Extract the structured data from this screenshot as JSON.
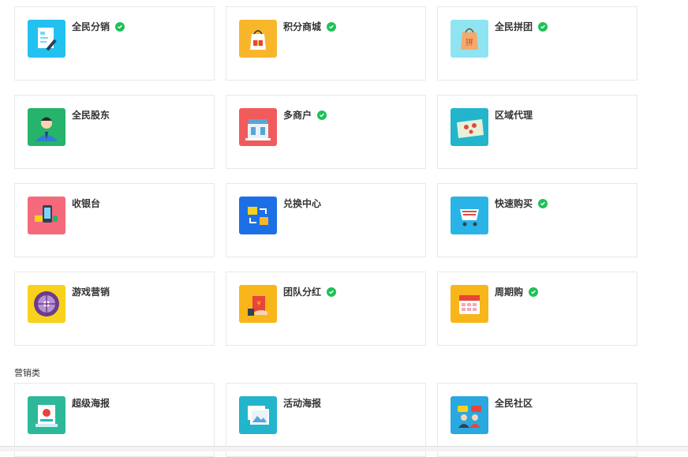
{
  "apps": [
    {
      "name": "全民分销",
      "wx": true,
      "icon": "distribution-icon",
      "color": "#22c1f0"
    },
    {
      "name": "积分商城",
      "wx": true,
      "icon": "points-mall-icon",
      "color": "#f8b62b"
    },
    {
      "name": "全民拼团",
      "wx": true,
      "icon": "group-buy-icon",
      "color": "#8fe4f2"
    },
    {
      "name": "全民股东",
      "wx": false,
      "icon": "shareholder-icon",
      "color": "#26b36b"
    },
    {
      "name": "多商户",
      "wx": true,
      "icon": "multi-merchant-icon",
      "color": "#f15b5b"
    },
    {
      "name": "区域代理",
      "wx": false,
      "icon": "regional-agent-icon",
      "color": "#22b5cc"
    },
    {
      "name": "收银台",
      "wx": false,
      "icon": "cashier-icon",
      "color": "#f56a7a"
    },
    {
      "name": "兑换中心",
      "wx": false,
      "icon": "exchange-center-icon",
      "color": "#1d6fe6"
    },
    {
      "name": "快速购买",
      "wx": true,
      "icon": "quick-buy-icon",
      "color": "#2ab3e6"
    },
    {
      "name": "游戏营销",
      "wx": false,
      "icon": "game-marketing-icon",
      "color": "#f8d21a"
    },
    {
      "name": "团队分红",
      "wx": true,
      "icon": "team-dividend-icon",
      "color": "#f8b61a"
    },
    {
      "name": "周期购",
      "wx": true,
      "icon": "cycle-purchase-icon",
      "color": "#f8b61a"
    }
  ],
  "section": "营销类",
  "marketing_apps": [
    {
      "name": "超级海报",
      "wx": false,
      "icon": "super-poster-icon",
      "color": "#2eb89a"
    },
    {
      "name": "活动海报",
      "wx": false,
      "icon": "activity-poster-icon",
      "color": "#22b5cc"
    },
    {
      "name": "全民社区",
      "wx": false,
      "icon": "community-icon",
      "color": "#2aa8e0"
    }
  ]
}
